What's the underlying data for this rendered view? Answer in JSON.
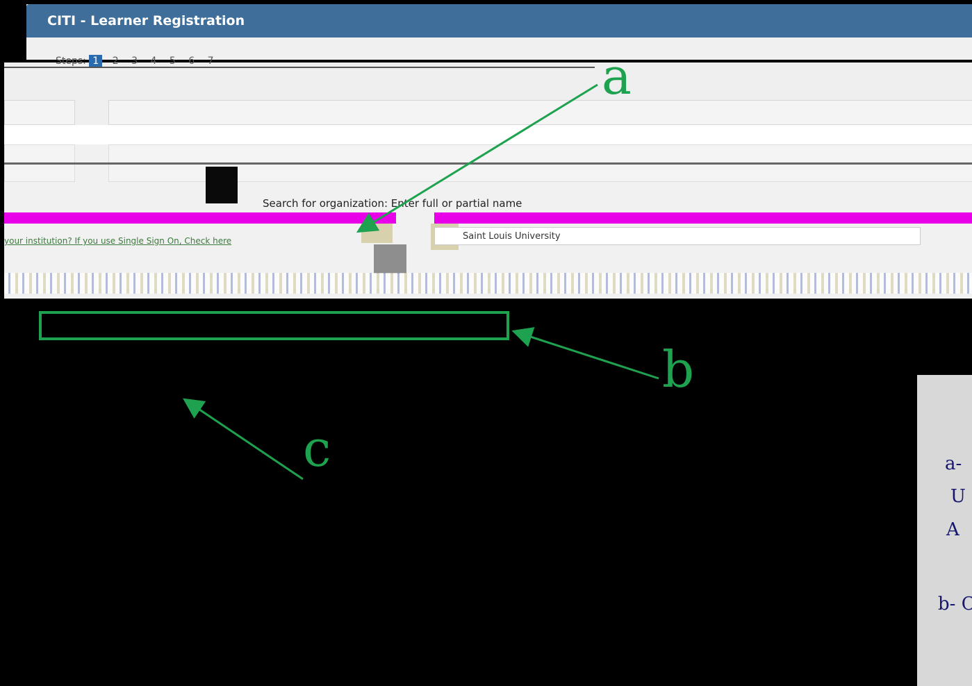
{
  "window": {
    "title": "CITI - Learner Registration"
  },
  "steps": {
    "prefix": "Steps:",
    "items": [
      "1",
      "2",
      "3",
      "4",
      "5",
      "6",
      "7"
    ],
    "active": "1"
  },
  "form": {
    "search_prompt": "Search for organization: Enter full or partial name",
    "org_link": "your institution? If you use Single Sign On, Check here",
    "org_value": "Saint Louis University"
  },
  "annotations": {
    "a": "a",
    "b": "b",
    "c": "c"
  },
  "legend": {
    "line1": "a-",
    "line2": "U",
    "line3": "A",
    "line4": "b- C"
  },
  "colors": {
    "titlebar": "#3f6e9a",
    "annotation": "#1ea24f",
    "highlight": "#e800e8",
    "legend_text": "#16166e"
  }
}
